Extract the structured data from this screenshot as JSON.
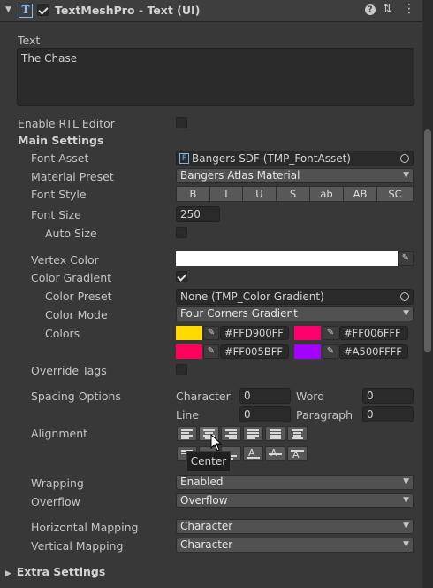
{
  "component": {
    "title": "TextMeshPro - Text (UI)",
    "icon": "text-component-icon",
    "enabled": true,
    "header_icons": [
      "help-icon",
      "presets-icon",
      "kebab-menu-icon"
    ]
  },
  "text": {
    "label": "Text",
    "value": "The Chase"
  },
  "enable_rtl": {
    "label": "Enable RTL Editor",
    "checked": false
  },
  "main_settings": {
    "label": "Main Settings",
    "font_asset": {
      "label": "Font Asset",
      "value": "Bangers SDF (TMP_FontAsset)"
    },
    "material_preset": {
      "label": "Material Preset",
      "value": "Bangers Atlas Material"
    },
    "font_style": {
      "label": "Font Style",
      "buttons": [
        "B",
        "I",
        "U",
        "S",
        "ab",
        "AB",
        "SC"
      ]
    },
    "font_size": {
      "label": "Font Size",
      "value": "250"
    },
    "auto_size": {
      "label": "Auto Size",
      "checked": false
    },
    "vertex_color": {
      "label": "Vertex Color",
      "color": "#FFFFFF"
    },
    "color_gradient": {
      "label": "Color Gradient",
      "checked": true
    },
    "color_preset": {
      "label": "Color Preset",
      "value": "None (TMP_Color Gradient)"
    },
    "color_mode": {
      "label": "Color Mode",
      "value": "Four Corners Gradient"
    },
    "colors": {
      "label": "Colors",
      "items": [
        {
          "hex": "#FFD900FF",
          "color": "#FFD900"
        },
        {
          "hex": "#FF006FFF",
          "color": "#FF006F"
        },
        {
          "hex": "#FF005BFF",
          "color": "#FF005B"
        },
        {
          "hex": "#A500FFFF",
          "color": "#A500FF"
        }
      ]
    },
    "override_tags": {
      "label": "Override Tags",
      "checked": false
    },
    "spacing": {
      "label": "Spacing Options",
      "character_label": "Character",
      "character_value": "0",
      "word_label": "Word",
      "word_value": "0",
      "line_label": "Line",
      "line_value": "0",
      "paragraph_label": "Paragraph",
      "paragraph_value": "0"
    },
    "alignment": {
      "label": "Alignment",
      "tooltip": "Center",
      "horizontal": [
        "align-left-icon",
        "align-center-icon",
        "align-right-icon",
        "align-justified-icon",
        "align-flush-icon",
        "align-geometry-center-icon"
      ],
      "vertical": [
        "align-top-icon",
        "align-middle-icon",
        "align-bottom-icon",
        "align-baseline-icon",
        "align-midline-icon",
        "align-capline-icon"
      ]
    },
    "wrapping": {
      "label": "Wrapping",
      "value": "Enabled"
    },
    "overflow": {
      "label": "Overflow",
      "value": "Overflow"
    },
    "horizontal_mapping": {
      "label": "Horizontal Mapping",
      "value": "Character"
    },
    "vertical_mapping": {
      "label": "Vertical Mapping",
      "value": "Character"
    }
  },
  "extra_settings": {
    "label": "Extra Settings"
  },
  "colors_theme": {
    "background": "#383838",
    "field": "#2a2a2a",
    "button": "#585858"
  }
}
